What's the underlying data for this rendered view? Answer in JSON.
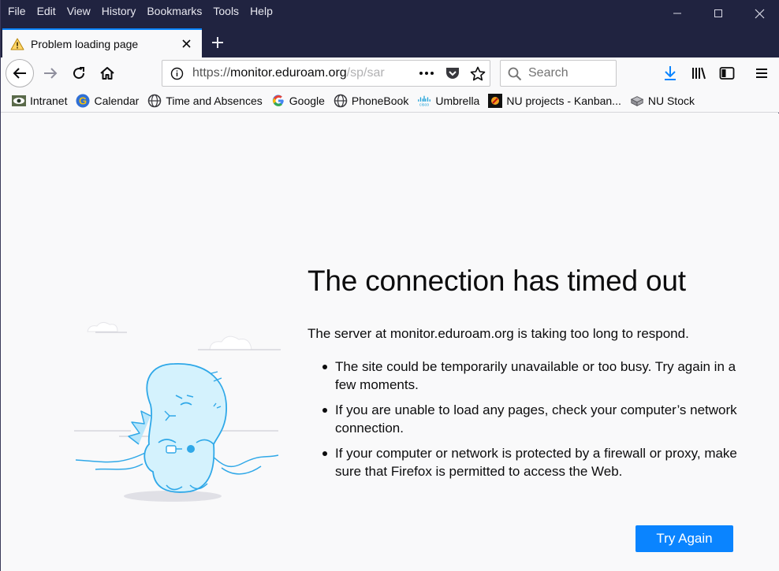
{
  "menu": [
    "File",
    "Edit",
    "View",
    "History",
    "Bookmarks",
    "Tools",
    "Help"
  ],
  "window_controls": {
    "minimize": "minimize-icon",
    "maximize": "maximize-icon",
    "close": "close-icon"
  },
  "tab": {
    "title": "Problem loading page",
    "icon": "warning-icon"
  },
  "navbar": {
    "url_prefix": "https://",
    "url_host": "monitor.eduroam.org",
    "url_path": "/sp/sar",
    "search_placeholder": "Search"
  },
  "bookmarks": [
    {
      "label": "Intranet",
      "icon": "eye-icon"
    },
    {
      "label": "Calendar",
      "icon": "g-logo-icon"
    },
    {
      "label": "Time and Absences",
      "icon": "globe-icon"
    },
    {
      "label": "Google",
      "icon": "google-icon"
    },
    {
      "label": "PhoneBook",
      "icon": "globe-icon"
    },
    {
      "label": "Umbrella",
      "icon": "cisco-icon"
    },
    {
      "label": "NU projects - Kanban...",
      "icon": "nu-icon"
    },
    {
      "label": "NU Stock",
      "icon": "box-icon"
    }
  ],
  "error": {
    "title": "The connection has timed out",
    "description": "The server at monitor.eduroam.org is taking too long to respond.",
    "items": [
      "The site could be temporarily unavailable or too busy. Try again in a few moments.",
      "If you are unable to load any pages, check your computer’s network connection.",
      "If your computer or network is protected by a firewall or proxy, make sure that Firefox is permitted to access the Web."
    ],
    "button": "Try Again"
  },
  "colors": {
    "titlebar": "#202340",
    "accent": "#0a84ff",
    "background": "#f9f9fa"
  }
}
